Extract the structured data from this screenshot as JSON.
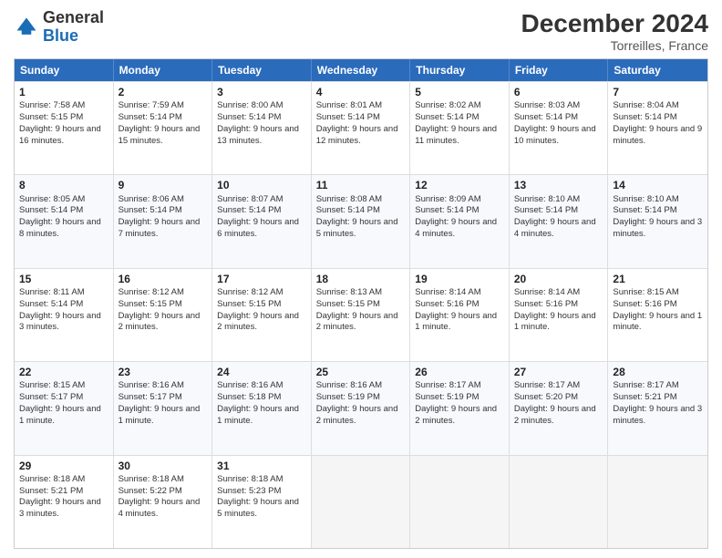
{
  "logo": {
    "general": "General",
    "blue": "Blue"
  },
  "header": {
    "month_year": "December 2024",
    "location": "Torreilles, France"
  },
  "days": [
    "Sunday",
    "Monday",
    "Tuesday",
    "Wednesday",
    "Thursday",
    "Friday",
    "Saturday"
  ],
  "weeks": [
    [
      {
        "day": "1",
        "sunrise": "7:58 AM",
        "sunset": "5:15 PM",
        "daylight": "9 hours and 16 minutes."
      },
      {
        "day": "2",
        "sunrise": "7:59 AM",
        "sunset": "5:14 PM",
        "daylight": "9 hours and 15 minutes."
      },
      {
        "day": "3",
        "sunrise": "8:00 AM",
        "sunset": "5:14 PM",
        "daylight": "9 hours and 13 minutes."
      },
      {
        "day": "4",
        "sunrise": "8:01 AM",
        "sunset": "5:14 PM",
        "daylight": "9 hours and 12 minutes."
      },
      {
        "day": "5",
        "sunrise": "8:02 AM",
        "sunset": "5:14 PM",
        "daylight": "9 hours and 11 minutes."
      },
      {
        "day": "6",
        "sunrise": "8:03 AM",
        "sunset": "5:14 PM",
        "daylight": "9 hours and 10 minutes."
      },
      {
        "day": "7",
        "sunrise": "8:04 AM",
        "sunset": "5:14 PM",
        "daylight": "9 hours and 9 minutes."
      }
    ],
    [
      {
        "day": "8",
        "sunrise": "8:05 AM",
        "sunset": "5:14 PM",
        "daylight": "9 hours and 8 minutes."
      },
      {
        "day": "9",
        "sunrise": "8:06 AM",
        "sunset": "5:14 PM",
        "daylight": "9 hours and 7 minutes."
      },
      {
        "day": "10",
        "sunrise": "8:07 AM",
        "sunset": "5:14 PM",
        "daylight": "9 hours and 6 minutes."
      },
      {
        "day": "11",
        "sunrise": "8:08 AM",
        "sunset": "5:14 PM",
        "daylight": "9 hours and 5 minutes."
      },
      {
        "day": "12",
        "sunrise": "8:09 AM",
        "sunset": "5:14 PM",
        "daylight": "9 hours and 4 minutes."
      },
      {
        "day": "13",
        "sunrise": "8:10 AM",
        "sunset": "5:14 PM",
        "daylight": "9 hours and 4 minutes."
      },
      {
        "day": "14",
        "sunrise": "8:10 AM",
        "sunset": "5:14 PM",
        "daylight": "9 hours and 3 minutes."
      }
    ],
    [
      {
        "day": "15",
        "sunrise": "8:11 AM",
        "sunset": "5:14 PM",
        "daylight": "9 hours and 3 minutes."
      },
      {
        "day": "16",
        "sunrise": "8:12 AM",
        "sunset": "5:15 PM",
        "daylight": "9 hours and 2 minutes."
      },
      {
        "day": "17",
        "sunrise": "8:12 AM",
        "sunset": "5:15 PM",
        "daylight": "9 hours and 2 minutes."
      },
      {
        "day": "18",
        "sunrise": "8:13 AM",
        "sunset": "5:15 PM",
        "daylight": "9 hours and 2 minutes."
      },
      {
        "day": "19",
        "sunrise": "8:14 AM",
        "sunset": "5:16 PM",
        "daylight": "9 hours and 1 minute."
      },
      {
        "day": "20",
        "sunrise": "8:14 AM",
        "sunset": "5:16 PM",
        "daylight": "9 hours and 1 minute."
      },
      {
        "day": "21",
        "sunrise": "8:15 AM",
        "sunset": "5:16 PM",
        "daylight": "9 hours and 1 minute."
      }
    ],
    [
      {
        "day": "22",
        "sunrise": "8:15 AM",
        "sunset": "5:17 PM",
        "daylight": "9 hours and 1 minute."
      },
      {
        "day": "23",
        "sunrise": "8:16 AM",
        "sunset": "5:17 PM",
        "daylight": "9 hours and 1 minute."
      },
      {
        "day": "24",
        "sunrise": "8:16 AM",
        "sunset": "5:18 PM",
        "daylight": "9 hours and 1 minute."
      },
      {
        "day": "25",
        "sunrise": "8:16 AM",
        "sunset": "5:19 PM",
        "daylight": "9 hours and 2 minutes."
      },
      {
        "day": "26",
        "sunrise": "8:17 AM",
        "sunset": "5:19 PM",
        "daylight": "9 hours and 2 minutes."
      },
      {
        "day": "27",
        "sunrise": "8:17 AM",
        "sunset": "5:20 PM",
        "daylight": "9 hours and 2 minutes."
      },
      {
        "day": "28",
        "sunrise": "8:17 AM",
        "sunset": "5:21 PM",
        "daylight": "9 hours and 3 minutes."
      }
    ],
    [
      {
        "day": "29",
        "sunrise": "8:18 AM",
        "sunset": "5:21 PM",
        "daylight": "9 hours and 3 minutes."
      },
      {
        "day": "30",
        "sunrise": "8:18 AM",
        "sunset": "5:22 PM",
        "daylight": "9 hours and 4 minutes."
      },
      {
        "day": "31",
        "sunrise": "8:18 AM",
        "sunset": "5:23 PM",
        "daylight": "9 hours and 5 minutes."
      },
      null,
      null,
      null,
      null
    ]
  ]
}
